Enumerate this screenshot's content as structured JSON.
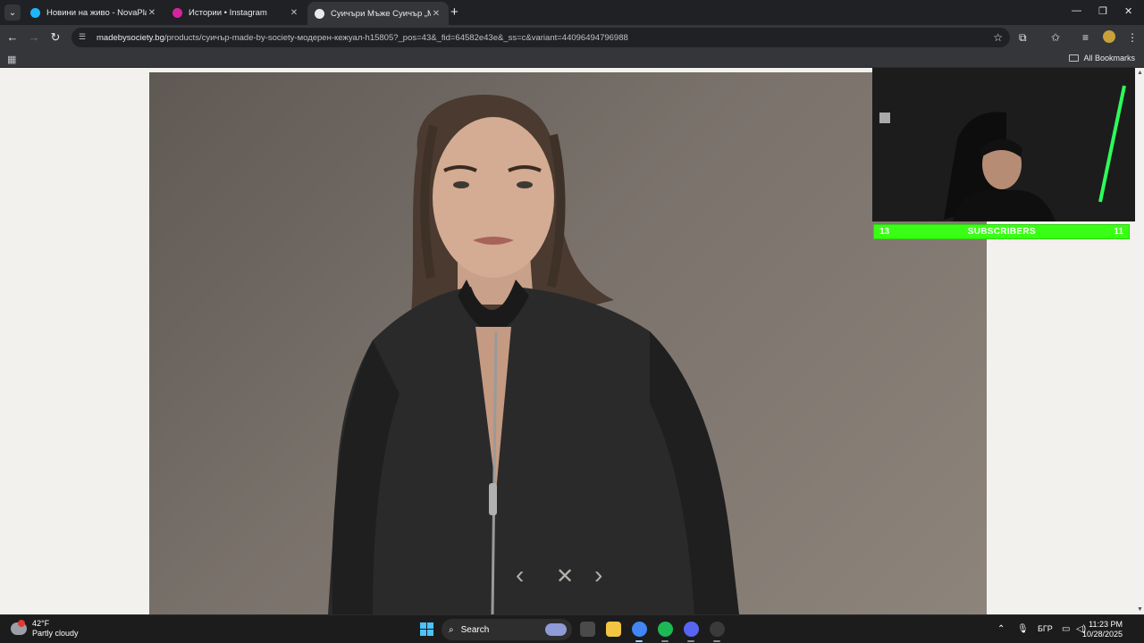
{
  "tabs": [
    {
      "label": "Новини на живо - NovaPlay",
      "favicon_color": "#1fb6ff",
      "active": false
    },
    {
      "label": "Истории • Instagram",
      "favicon_color": "#d6249f",
      "active": false
    },
    {
      "label": "Суичъри Мъже Суичър „Mad",
      "favicon_color": "#e8eaed",
      "active": true
    }
  ],
  "toolbar": {
    "url_domain": "madebysociety.bg",
    "url_path": "/products/суичър-made-by-society-модерен-кежуал-h15805?_pos=43&_fid=64582e43e&_ss=c&variant=44096494796988"
  },
  "bookmarks": {
    "all_label": "All Bookmarks"
  },
  "lightbox": {
    "prev_icon": "‹",
    "close_icon": "✕",
    "next_icon": "›"
  },
  "overlay": {
    "left_count": "13",
    "label": "SUBSCRIBERS",
    "right_count": "11",
    "bar_color": "#39ff14"
  },
  "taskbar": {
    "temperature": "42°F",
    "condition": "Partly cloudy",
    "search_label": "Search",
    "language": "БГР",
    "time": "11:23 PM",
    "date": "10/28/2025"
  }
}
